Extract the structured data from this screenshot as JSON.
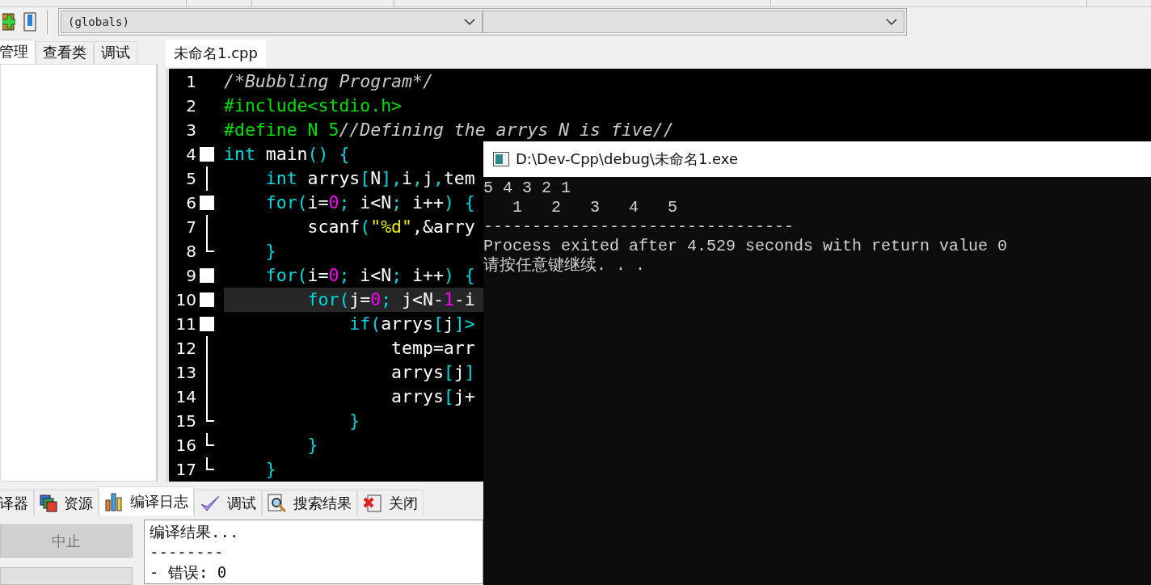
{
  "toolbar": {
    "scope_dropdown": {
      "value": "(globals)"
    }
  },
  "left_panel": {
    "tabs": [
      {
        "label": "管理",
        "selected": true
      },
      {
        "label": "查看类",
        "selected": false
      },
      {
        "label": "调试",
        "selected": false
      }
    ]
  },
  "editor": {
    "tab": {
      "label": "未命名1.cpp",
      "selected": true
    },
    "lines": [
      {
        "number": "1",
        "kind": "plain",
        "current": false,
        "tokens": [
          {
            "kind": "comment",
            "text": "/*Bubbling Program*/"
          }
        ]
      },
      {
        "number": "2",
        "kind": "plain",
        "current": false,
        "tokens": [
          {
            "kind": "preproc",
            "text": "#include<stdio.h>"
          }
        ]
      },
      {
        "number": "3",
        "kind": "plain",
        "current": false,
        "tokens": [
          {
            "kind": "preproc",
            "text": "#define N 5"
          },
          {
            "kind": "comment",
            "text": "//Defining the arrys N is five//"
          }
        ]
      },
      {
        "number": "4",
        "kind": "foldstart",
        "current": false,
        "tokens": [
          {
            "kind": "keyword",
            "text": "int"
          },
          {
            "kind": "plain",
            "text": " main"
          },
          {
            "kind": "symbol",
            "text": "() {"
          }
        ]
      },
      {
        "number": "5",
        "kind": "foldbody",
        "current": false,
        "tokens": [
          {
            "kind": "keyword",
            "text": "    int"
          },
          {
            "kind": "plain",
            "text": " arrys"
          },
          {
            "kind": "symbol",
            "text": "["
          },
          {
            "kind": "plain",
            "text": "N"
          },
          {
            "kind": "symbol",
            "text": "],"
          },
          {
            "kind": "plain",
            "text": "i"
          },
          {
            "kind": "symbol",
            "text": ","
          },
          {
            "kind": "plain",
            "text": "j"
          },
          {
            "kind": "symbol",
            "text": ","
          },
          {
            "kind": "plain",
            "text": "tem"
          }
        ]
      },
      {
        "number": "6",
        "kind": "foldstart",
        "current": false,
        "tokens": [
          {
            "kind": "keyword",
            "text": "    for"
          },
          {
            "kind": "symbol",
            "text": "("
          },
          {
            "kind": "plain",
            "text": "i="
          },
          {
            "kind": "number",
            "text": "0"
          },
          {
            "kind": "symbol",
            "text": ";"
          },
          {
            "kind": "plain",
            "text": " i<N"
          },
          {
            "kind": "symbol",
            "text": ";"
          },
          {
            "kind": "plain",
            "text": " i++"
          },
          {
            "kind": "symbol",
            "text": ") {"
          }
        ]
      },
      {
        "number": "7",
        "kind": "foldbody",
        "current": false,
        "tokens": [
          {
            "kind": "plain",
            "text": "        scanf"
          },
          {
            "kind": "symbol",
            "text": "("
          },
          {
            "kind": "string",
            "text": "\"%d\""
          },
          {
            "kind": "plain",
            "text": ",&arry"
          }
        ]
      },
      {
        "number": "8",
        "kind": "foldend",
        "current": false,
        "tokens": [
          {
            "kind": "symbol",
            "text": "    }"
          }
        ]
      },
      {
        "number": "9",
        "kind": "foldstart",
        "current": false,
        "tokens": [
          {
            "kind": "keyword",
            "text": "    for"
          },
          {
            "kind": "symbol",
            "text": "("
          },
          {
            "kind": "plain",
            "text": "i="
          },
          {
            "kind": "number",
            "text": "0"
          },
          {
            "kind": "symbol",
            "text": ";"
          },
          {
            "kind": "plain",
            "text": " i<N"
          },
          {
            "kind": "symbol",
            "text": ";"
          },
          {
            "kind": "plain",
            "text": " i++"
          },
          {
            "kind": "symbol",
            "text": ") {"
          }
        ]
      },
      {
        "number": "10",
        "kind": "foldstart",
        "current": true,
        "tokens": [
          {
            "kind": "keyword",
            "text": "        for"
          },
          {
            "kind": "symbol",
            "text": "("
          },
          {
            "kind": "plain",
            "text": "j="
          },
          {
            "kind": "number",
            "text": "0"
          },
          {
            "kind": "symbol",
            "text": ";"
          },
          {
            "kind": "plain",
            "text": " j<N-"
          },
          {
            "kind": "number",
            "text": "1"
          },
          {
            "kind": "plain",
            "text": "-i"
          }
        ]
      },
      {
        "number": "11",
        "kind": "foldstart",
        "current": false,
        "tokens": [
          {
            "kind": "keyword",
            "text": "            if"
          },
          {
            "kind": "symbol",
            "text": "("
          },
          {
            "kind": "plain",
            "text": "arrys"
          },
          {
            "kind": "symbol",
            "text": "["
          },
          {
            "kind": "plain",
            "text": "j"
          },
          {
            "kind": "symbol",
            "text": "]>"
          }
        ]
      },
      {
        "number": "12",
        "kind": "foldbody",
        "current": false,
        "tokens": [
          {
            "kind": "plain",
            "text": "                temp=arr"
          }
        ]
      },
      {
        "number": "13",
        "kind": "foldbody",
        "current": false,
        "tokens": [
          {
            "kind": "plain",
            "text": "                arrys"
          },
          {
            "kind": "symbol",
            "text": "["
          },
          {
            "kind": "plain",
            "text": "j"
          },
          {
            "kind": "symbol",
            "text": "]"
          }
        ]
      },
      {
        "number": "14",
        "kind": "foldbody",
        "current": false,
        "tokens": [
          {
            "kind": "plain",
            "text": "                arrys"
          },
          {
            "kind": "symbol",
            "text": "["
          },
          {
            "kind": "plain",
            "text": "j+"
          }
        ]
      },
      {
        "number": "15",
        "kind": "foldend",
        "current": false,
        "tokens": [
          {
            "kind": "symbol",
            "text": "            }"
          }
        ]
      },
      {
        "number": "16",
        "kind": "foldend",
        "current": false,
        "tokens": [
          {
            "kind": "symbol",
            "text": "        }"
          }
        ]
      },
      {
        "number": "17",
        "kind": "foldend",
        "current": false,
        "tokens": [
          {
            "kind": "symbol",
            "text": "    }"
          }
        ]
      }
    ]
  },
  "bottom_panel": {
    "tabs": [
      {
        "label": "译器",
        "selected": false
      },
      {
        "label": "资源",
        "selected": false
      },
      {
        "label": "编译日志",
        "selected": true
      },
      {
        "label": "调试",
        "selected": false
      },
      {
        "label": "搜索结果",
        "selected": false
      },
      {
        "label": "关闭",
        "selected": false
      }
    ],
    "abort_button": {
      "label": "中止",
      "disabled": true
    },
    "log": [
      "编译结果...",
      "--------",
      "- 错误: 0"
    ]
  },
  "console": {
    "title": "D:\\Dev-Cpp\\debug\\未命名1.exe",
    "lines": [
      "5 4 3 2 1",
      "   1   2   3   4   5",
      "--------------------------------",
      "Process exited after 4.529 seconds with return value 0",
      "请按任意键继续. . ."
    ]
  }
}
